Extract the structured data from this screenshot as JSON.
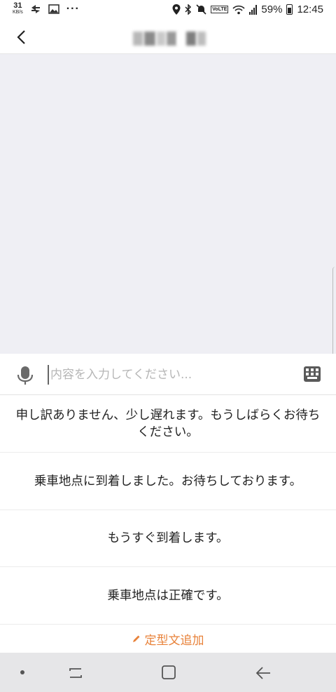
{
  "status_bar": {
    "speed_value": "31",
    "speed_unit": "KB/s",
    "more": "···",
    "volte": "VoLTE",
    "battery": "59%",
    "time": "12:45"
  },
  "header": {
    "back_icon": "chevron-left-icon"
  },
  "input": {
    "placeholder": "内容を入力してください..."
  },
  "phrases": [
    "申し訳ありません、少し遅れます。もうしばらくお待ちください。",
    "乗車地点に到着しました。お待ちしております。",
    "もうすぐ到着します。",
    "乗車地点は正確です。"
  ],
  "add_phrase_label": "定型文追加",
  "colors": {
    "accent": "#e8823a",
    "chat_bg": "#efeff4",
    "navbar_bg": "#e6e6e8"
  }
}
